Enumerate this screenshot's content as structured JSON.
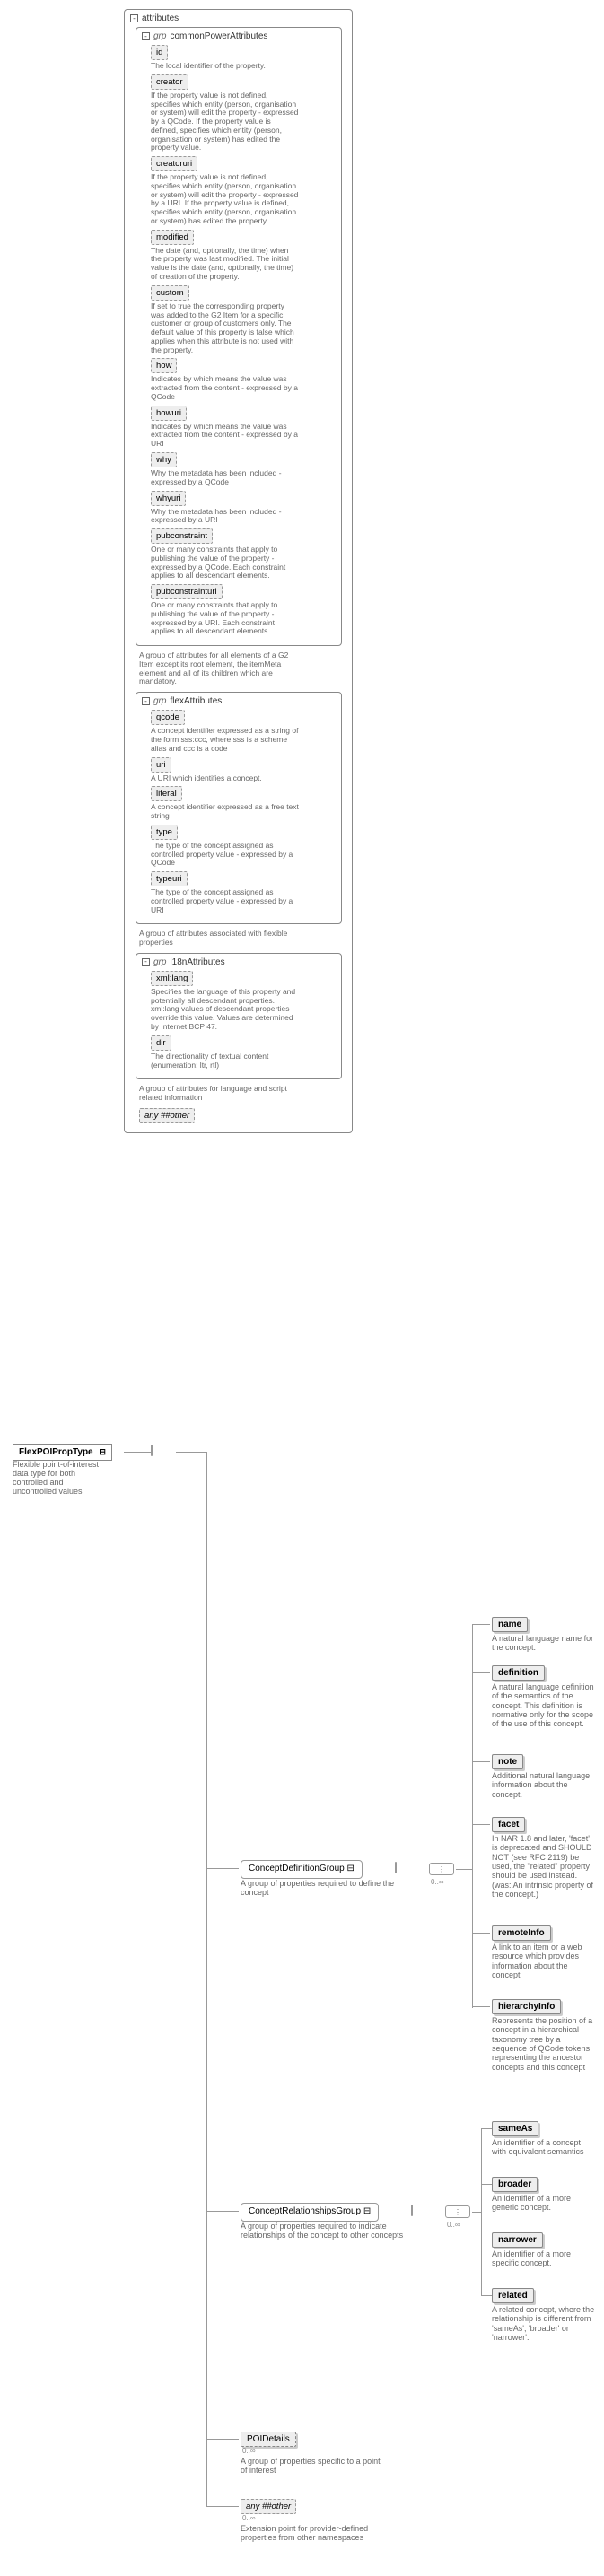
{
  "root": {
    "label": "FlexPOIPropType",
    "desc": "Flexible point-of-interest data type for both controlled and uncontrolled values"
  },
  "attributes_word": "attributes",
  "grp_prefix": "grp",
  "common": {
    "name": "commonPowerAttributes",
    "items": {
      "id": {
        "label": "id",
        "desc": "The local identifier of the property."
      },
      "creator": {
        "label": "creator",
        "desc": "If the property value is not defined, specifies which entity (person, organisation or system) will edit the property - expressed by a QCode. If the property value is defined, specifies which entity (person, organisation or system) has edited the property value."
      },
      "creatoruri": {
        "label": "creatoruri",
        "desc": "If the property value is not defined, specifies which entity (person, organisation or system) will edit the property - expressed by a URI. If the property value is defined, specifies which entity (person, organisation or system) has edited the property."
      },
      "modified": {
        "label": "modified",
        "desc": "The date (and, optionally, the time) when the property was last modified. The initial value is the date (and, optionally, the time) of creation of the property."
      },
      "custom": {
        "label": "custom",
        "desc": "If set to true the corresponding property was added to the G2 Item for a specific customer or group of customers only. The default value of this property is false which applies when this attribute is not used with the property."
      },
      "how": {
        "label": "how",
        "desc": "Indicates by which means the value was extracted from the content - expressed by a QCode"
      },
      "howuri": {
        "label": "howuri",
        "desc": "Indicates by which means the value was extracted from the content - expressed by a URI"
      },
      "why": {
        "label": "why",
        "desc": "Why the metadata has been included - expressed by a QCode"
      },
      "whyuri": {
        "label": "whyuri",
        "desc": "Why the metadata has been included - expressed by a URI"
      },
      "pubconstraint": {
        "label": "pubconstraint",
        "desc": "One or many constraints that apply to publishing the value of the property - expressed by a QCode. Each constraint applies to all descendant elements."
      },
      "pubconstrainturi": {
        "label": "pubconstrainturi",
        "desc": "One or many constraints that apply to publishing the value of the property - expressed by a URI. Each constraint applies to all descendant elements."
      }
    },
    "grp_desc": "A group of attributes for all elements of a G2 Item except its root element, the itemMeta element and all of its children which are mandatory."
  },
  "flex": {
    "name": "flexAttributes",
    "items": {
      "qcode": {
        "label": "qcode",
        "desc": "A concept identifier expressed as a string of the form sss:ccc, where sss is a scheme alias and ccc is a code"
      },
      "uri": {
        "label": "uri",
        "desc": "A URI which identifies a concept."
      },
      "literal": {
        "label": "literal",
        "desc": "A concept identifier expressed as a free text string"
      },
      "type": {
        "label": "type",
        "desc": "The type of the concept assigned as controlled property value - expressed by a QCode"
      },
      "typeuri": {
        "label": "typeuri",
        "desc": "The type of the concept assigned as controlled property value - expressed by a URI"
      }
    },
    "grp_desc": "A group of attributes associated with flexible properties"
  },
  "i18n": {
    "name": "i18nAttributes",
    "items": {
      "xmllang": {
        "label": "xml:lang",
        "desc": "Specifies the language of this property and potentially all descendant properties. xml:lang values of descendant properties override this value. Values are determined by Internet BCP 47."
      },
      "dir": {
        "label": "dir",
        "desc": "The directionality of textual content (enumeration: ltr, rtl)"
      }
    },
    "grp_desc": "A group of attributes for language and script related information"
  },
  "anyhash": {
    "label": "any ##other"
  },
  "conceptDef": {
    "group_label": "ConceptDefinitionGroup",
    "group_desc": "A group of properties required to define the concept",
    "items": {
      "name": {
        "label": "name",
        "desc": "A natural language name for the concept."
      },
      "definition": {
        "label": "definition",
        "desc": "A natural language definition of the semantics of the concept. This definition is normative only for the scope of the use of this concept."
      },
      "note": {
        "label": "note",
        "desc": "Additional natural language information about the concept."
      },
      "facet": {
        "label": "facet",
        "desc": "In NAR 1.8 and later, 'facet' is deprecated and SHOULD NOT (see RFC 2119) be used, the \"related\" property should be used instead. (was: An intrinsic property of the concept.)"
      },
      "remoteInfo": {
        "label": "remoteInfo",
        "desc": "A link to an item or a web resource which provides information about the concept"
      },
      "hierarchyInfo": {
        "label": "hierarchyInfo",
        "desc": "Represents the position of a concept in a hierarchical taxonomy tree by a sequence of QCode tokens representing the ancestor concepts and this concept"
      }
    }
  },
  "conceptRel": {
    "group_label": "ConceptRelationshipsGroup",
    "group_desc": "A group of properties required to indicate relationships of the concept to other concepts",
    "items": {
      "sameAs": {
        "label": "sameAs",
        "desc": "An identifier of a concept with equivalent semantics"
      },
      "broader": {
        "label": "broader",
        "desc": "An identifier of a more generic concept."
      },
      "narrower": {
        "label": "narrower",
        "desc": "An identifier of a more specific concept."
      },
      "related": {
        "label": "related",
        "desc": "A related concept, where the relationship is different from 'sameAs', 'broader' or 'narrower'."
      }
    }
  },
  "poi": {
    "label": "POIDetails",
    "desc": "A group of properties specific to a point of interest"
  },
  "extension": {
    "label": "any ##other",
    "desc": "Extension point for provider-defined properties from other namespaces"
  },
  "card": {
    "zero_inf": "0..∞"
  }
}
